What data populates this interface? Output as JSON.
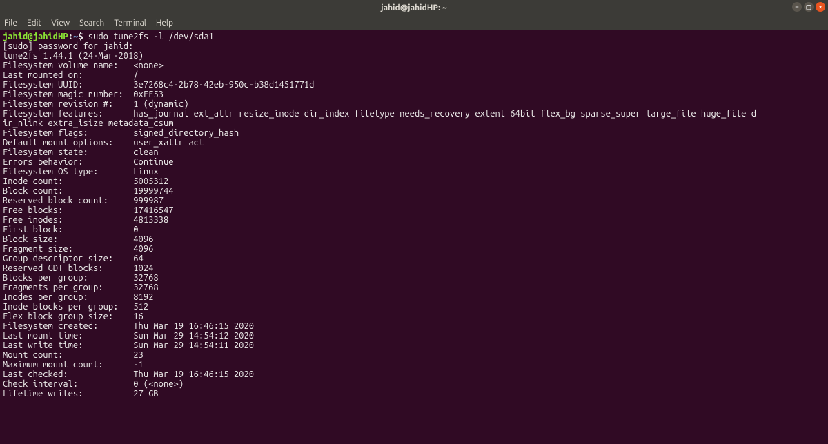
{
  "window": {
    "title": "jahid@jahidHP: ~"
  },
  "menu": {
    "file": "File",
    "edit": "Edit",
    "view": "View",
    "search": "Search",
    "terminal": "Terminal",
    "help": "Help"
  },
  "prompt": {
    "userhost": "jahid@jahidHP",
    "colon": ":",
    "path": "~",
    "dollar": "$ ",
    "command": "sudo tune2fs -l /dev/sda1"
  },
  "lines": {
    "l0": "[sudo] password for jahid: ",
    "l1": "tune2fs 1.44.1 (24-Mar-2018)"
  },
  "kv": [
    {
      "k": "Filesystem volume name:   ",
      "v": "<none>"
    },
    {
      "k": "Last mounted on:          ",
      "v": "/"
    },
    {
      "k": "Filesystem UUID:          ",
      "v": "3e7268c4-2b78-42eb-950c-b38d1451771d"
    },
    {
      "k": "Filesystem magic number:  ",
      "v": "0xEF53"
    },
    {
      "k": "Filesystem revision #:    ",
      "v": "1 (dynamic)"
    },
    {
      "k": "Filesystem features:      ",
      "v": "has_journal ext_attr resize_inode dir_index filetype needs_recovery extent 64bit flex_bg sparse_super large_file huge_file d"
    },
    {
      "k": "ir_nlink extra_isize metadata_csum",
      "v": ""
    },
    {
      "k": "Filesystem flags:         ",
      "v": "signed_directory_hash "
    },
    {
      "k": "Default mount options:    ",
      "v": "user_xattr acl"
    },
    {
      "k": "Filesystem state:         ",
      "v": "clean"
    },
    {
      "k": "Errors behavior:          ",
      "v": "Continue"
    },
    {
      "k": "Filesystem OS type:       ",
      "v": "Linux"
    },
    {
      "k": "Inode count:              ",
      "v": "5005312"
    },
    {
      "k": "Block count:              ",
      "v": "19999744"
    },
    {
      "k": "Reserved block count:     ",
      "v": "999987"
    },
    {
      "k": "Free blocks:              ",
      "v": "17416547"
    },
    {
      "k": "Free inodes:              ",
      "v": "4813338"
    },
    {
      "k": "First block:              ",
      "v": "0"
    },
    {
      "k": "Block size:               ",
      "v": "4096"
    },
    {
      "k": "Fragment size:            ",
      "v": "4096"
    },
    {
      "k": "Group descriptor size:    ",
      "v": "64"
    },
    {
      "k": "Reserved GDT blocks:      ",
      "v": "1024"
    },
    {
      "k": "Blocks per group:         ",
      "v": "32768"
    },
    {
      "k": "Fragments per group:      ",
      "v": "32768"
    },
    {
      "k": "Inodes per group:         ",
      "v": "8192"
    },
    {
      "k": "Inode blocks per group:   ",
      "v": "512"
    },
    {
      "k": "Flex block group size:    ",
      "v": "16"
    },
    {
      "k": "Filesystem created:       ",
      "v": "Thu Mar 19 16:46:15 2020"
    },
    {
      "k": "Last mount time:          ",
      "v": "Sun Mar 29 14:54:12 2020"
    },
    {
      "k": "Last write time:          ",
      "v": "Sun Mar 29 14:54:11 2020"
    },
    {
      "k": "Mount count:              ",
      "v": "23"
    },
    {
      "k": "Maximum mount count:      ",
      "v": "-1"
    },
    {
      "k": "Last checked:             ",
      "v": "Thu Mar 19 16:46:15 2020"
    },
    {
      "k": "Check interval:           ",
      "v": "0 (<none>)"
    },
    {
      "k": "Lifetime writes:          ",
      "v": "27 GB"
    }
  ]
}
